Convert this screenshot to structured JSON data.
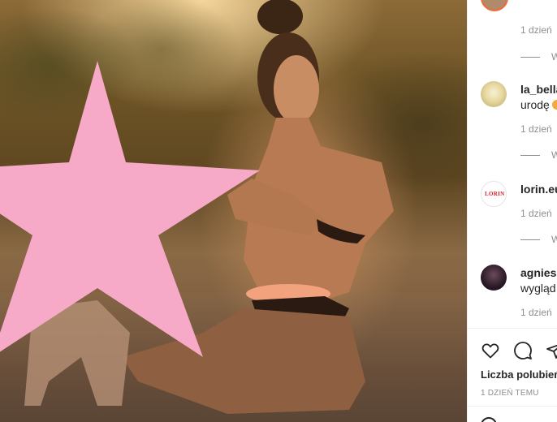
{
  "photo": {
    "description_icon": "photo",
    "censor_star_color": "#f7a9c8"
  },
  "comments": [
    {
      "username": "",
      "text": "",
      "time": "1 dzień",
      "replies_label": "W"
    },
    {
      "username": "la_bella",
      "text": "urodę",
      "time": "1 dzień",
      "replies_label": "W"
    },
    {
      "username": "lorin.eu",
      "text": "",
      "time": "1 dzień",
      "replies_label": "W",
      "avatar_logo": "LORIN"
    },
    {
      "username": "agniesz",
      "text": "wygląd",
      "time": "1 dzień"
    }
  ],
  "actions": {
    "like_icon": "heart-icon",
    "comment_icon": "comment-icon",
    "share_icon": "share-icon"
  },
  "likes_label": "Liczba polubień",
  "post_time": "1 DZIEŃ TEMU",
  "colors": {
    "text": "#262626",
    "muted": "#8e8e8e",
    "border": "#efefef",
    "star": "#f7a9c8"
  }
}
